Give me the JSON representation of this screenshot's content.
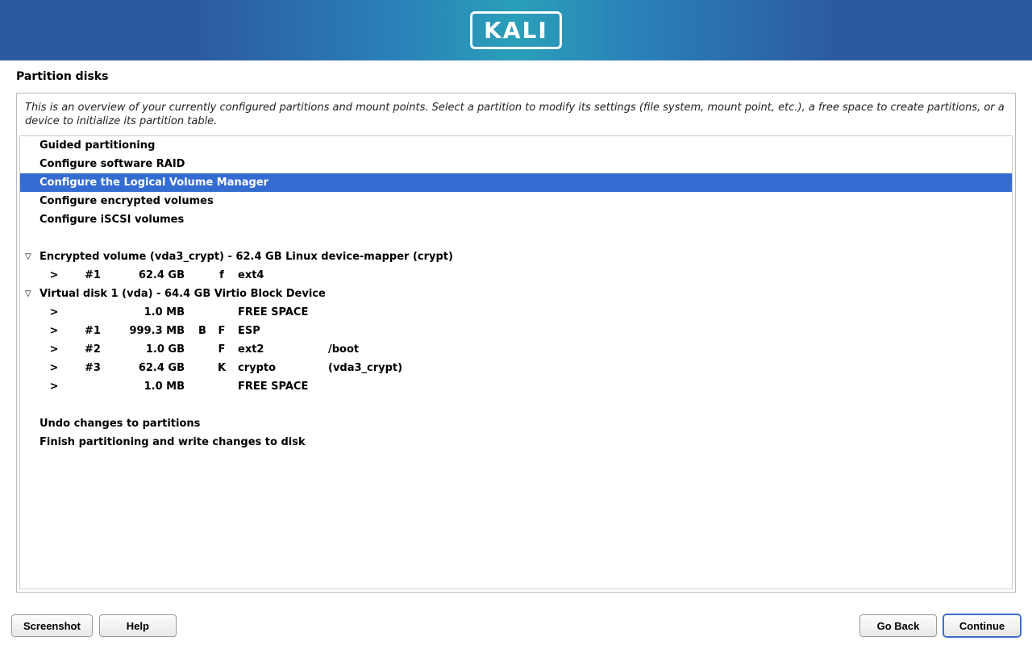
{
  "logo": "KALI",
  "page_title": "Partition disks",
  "intro": "This is an overview of your currently configured partitions and mount points. Select a partition to modify its settings (file system, mount point, etc.), a free space to create partitions, or a device to initialize its partition table.",
  "menu": {
    "guided": "Guided partitioning",
    "raid": "Configure software RAID",
    "lvm": "Configure the Logical Volume Manager",
    "encrypted": "Configure encrypted volumes",
    "iscsi": "Configure iSCSI volumes"
  },
  "devices": [
    {
      "header": "Encrypted volume (vda3_crypt) - 62.4 GB Linux device-mapper (crypt)",
      "rows": [
        {
          "arrow": ">",
          "num": "#1",
          "size": "62.4 GB",
          "f1": "",
          "f2": "f",
          "fs": "ext4",
          "mount": ""
        }
      ]
    },
    {
      "header": "Virtual disk 1 (vda) - 64.4 GB Virtio Block Device",
      "rows": [
        {
          "arrow": ">",
          "num": "",
          "size": "1.0 MB",
          "f1": "",
          "f2": "",
          "fs": "FREE SPACE",
          "mount": ""
        },
        {
          "arrow": ">",
          "num": "#1",
          "size": "999.3 MB",
          "f1": "B",
          "f2": "F",
          "fs": "ESP",
          "mount": ""
        },
        {
          "arrow": ">",
          "num": "#2",
          "size": "1.0 GB",
          "f1": "",
          "f2": "F",
          "fs": "ext2",
          "mount": "/boot"
        },
        {
          "arrow": ">",
          "num": "#3",
          "size": "62.4 GB",
          "f1": "",
          "f2": "K",
          "fs": "crypto",
          "mount": "(vda3_crypt)"
        },
        {
          "arrow": ">",
          "num": "",
          "size": "1.0 MB",
          "f1": "",
          "f2": "",
          "fs": "FREE SPACE",
          "mount": ""
        }
      ]
    }
  ],
  "actions": {
    "undo": "Undo changes to partitions",
    "finish": "Finish partitioning and write changes to disk"
  },
  "buttons": {
    "screenshot": "Screenshot",
    "help": "Help",
    "goback": "Go Back",
    "continue": "Continue"
  }
}
